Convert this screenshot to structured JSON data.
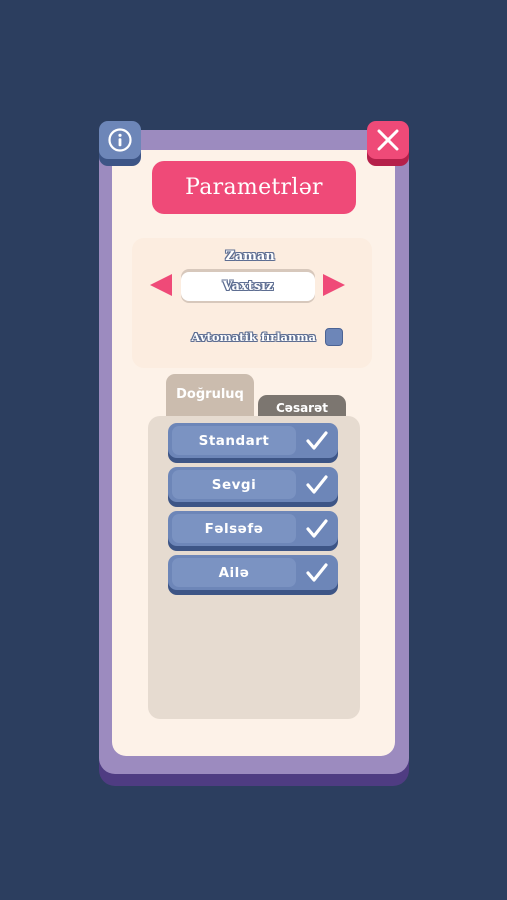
{
  "dialog": {
    "title": "Parametrlər",
    "info_icon": "info-icon",
    "close_icon": "close-icon"
  },
  "time": {
    "label": "Zaman",
    "value": "Vaxtsız",
    "prev_icon": "triangle-left-icon",
    "next_icon": "triangle-right-icon"
  },
  "auto_rotate": {
    "label": "Avtomatik fırlanma",
    "checked": false
  },
  "tabs": [
    {
      "label": "Doğruluq",
      "active": true
    },
    {
      "label": "Cəsarət",
      "active": false
    }
  ],
  "packs": [
    {
      "label": "Standart",
      "checked": true
    },
    {
      "label": "Sevgi",
      "checked": true
    },
    {
      "label": "Fəlsəfə",
      "checked": true
    },
    {
      "label": "Ailə",
      "checked": true
    }
  ],
  "colors": {
    "background": "#2c3e5f",
    "frame": "#9c8bbf",
    "panel": "#fdf2e8",
    "accent_pink": "#ef4a78",
    "button_blue": "#6d86b8"
  }
}
